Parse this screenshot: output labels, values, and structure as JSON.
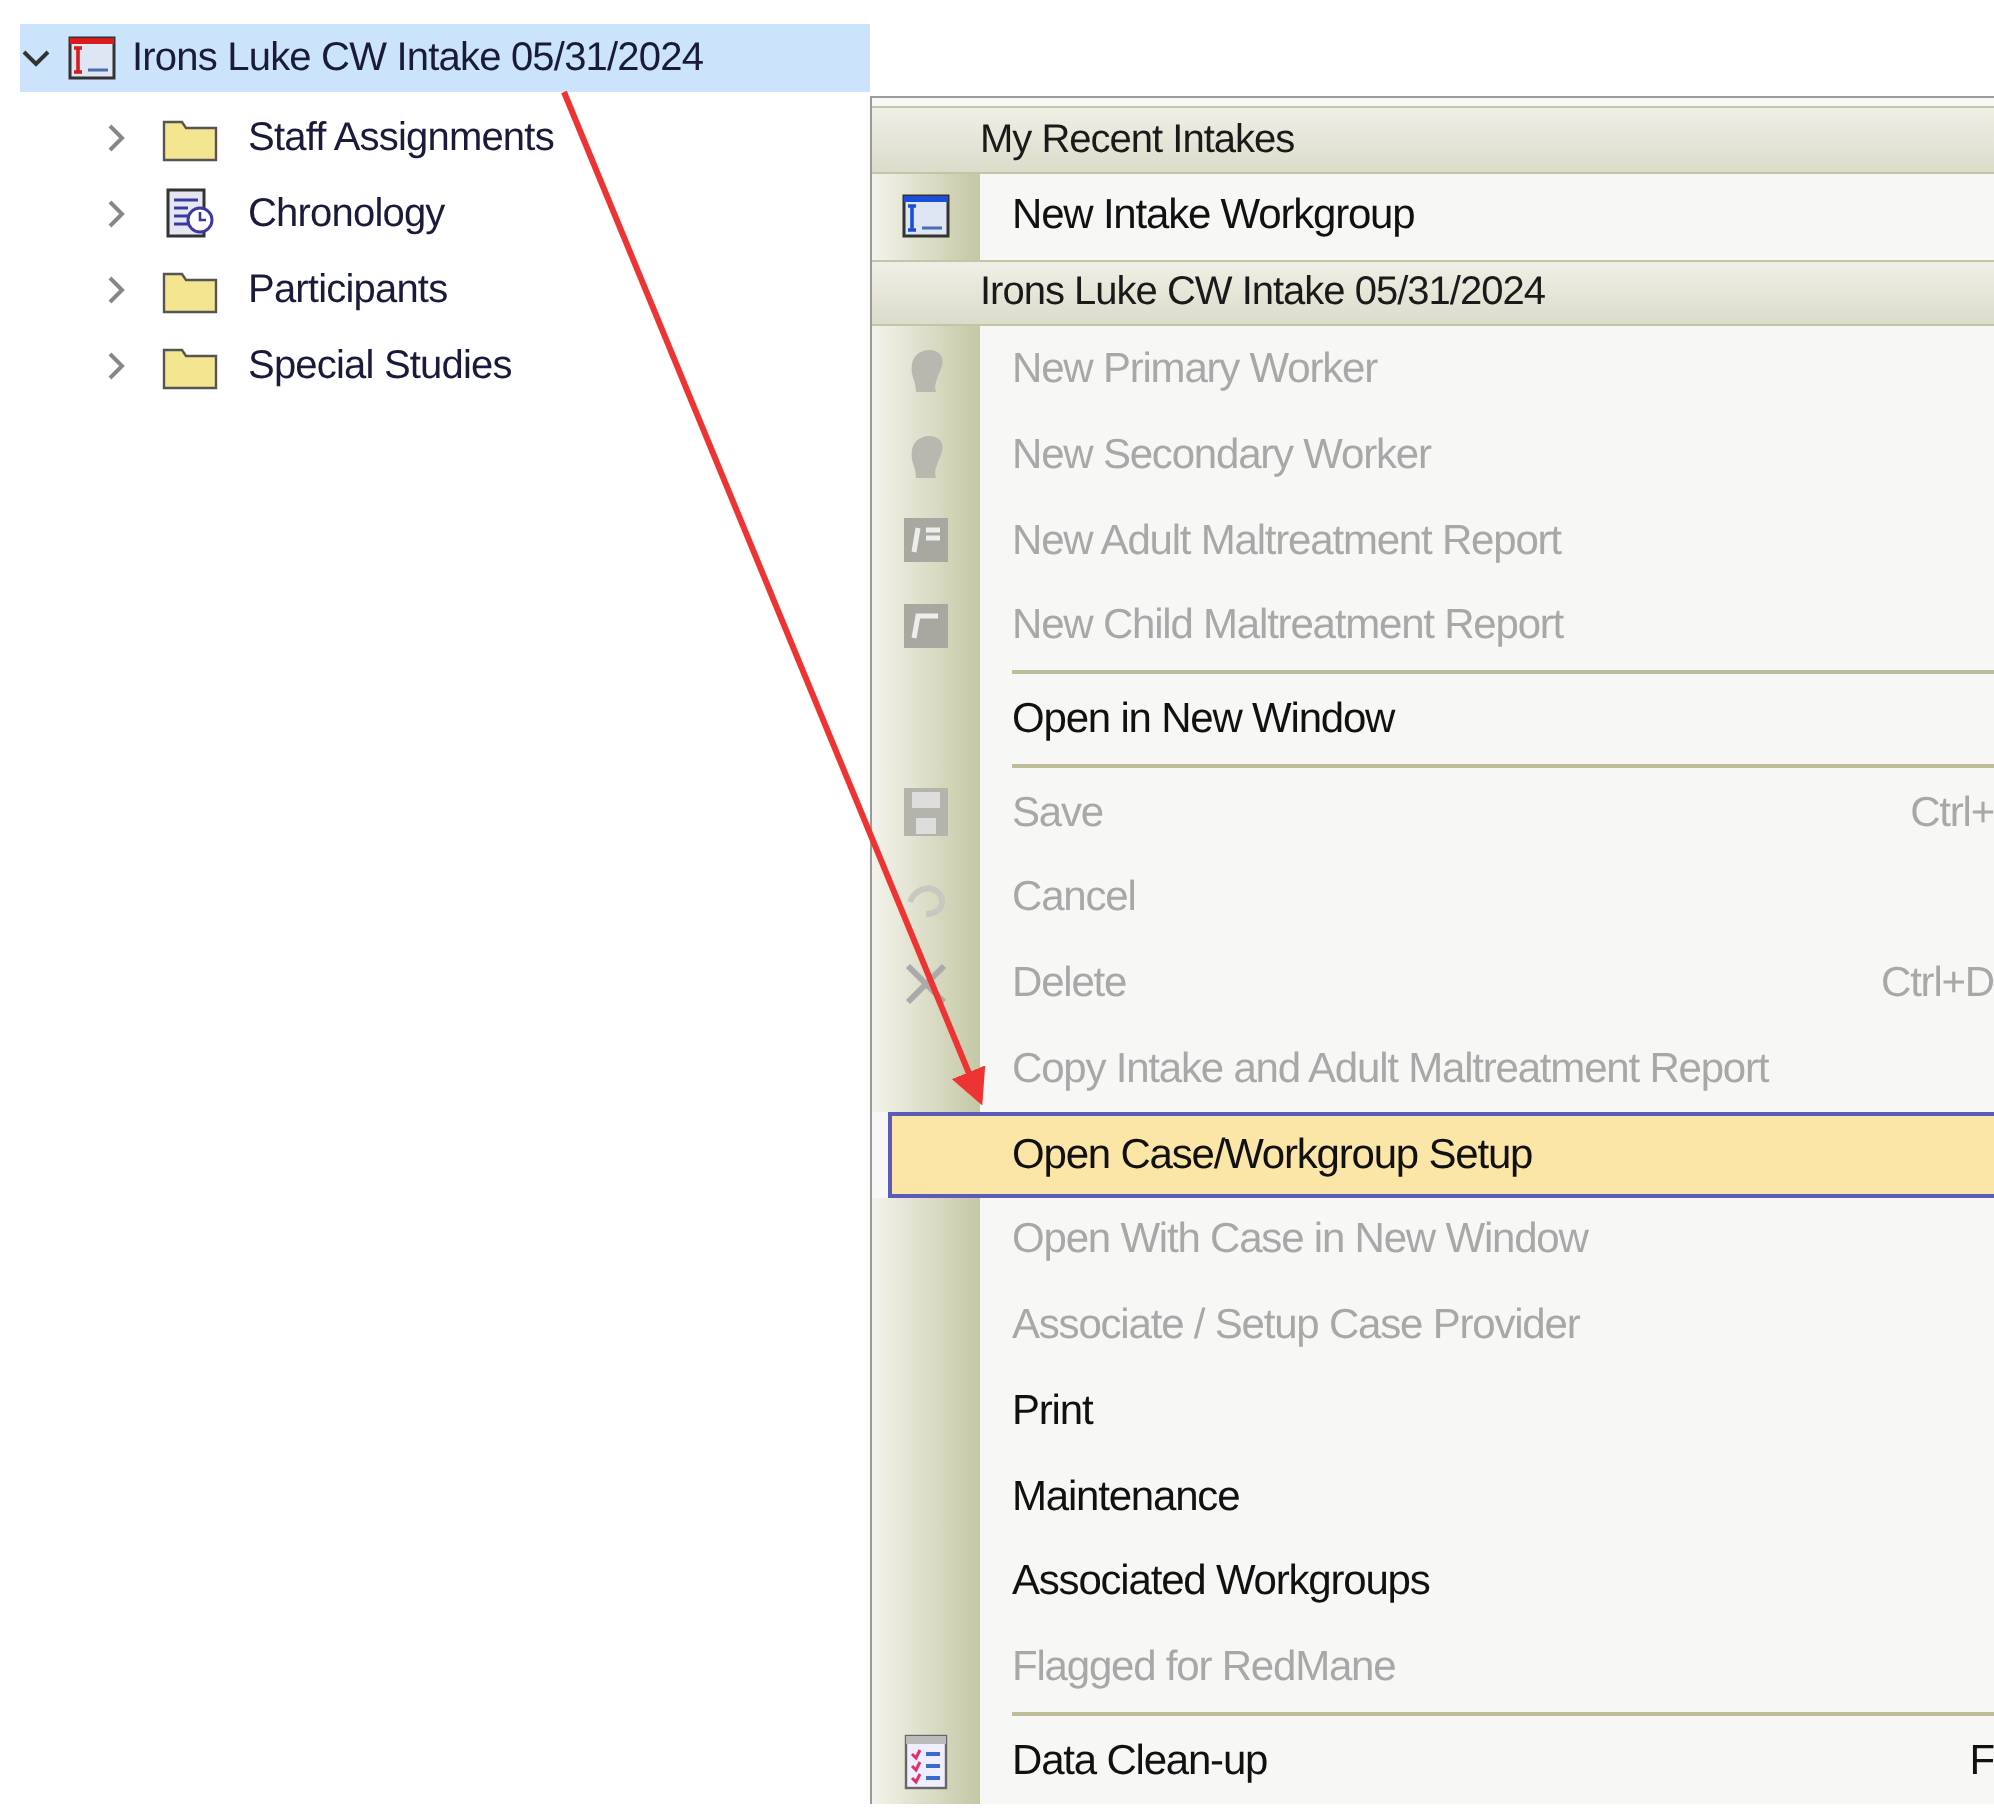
{
  "tree": {
    "label": "Irons Luke CW Intake 05/31/2024",
    "selected": true,
    "expanded": true,
    "children": [
      {
        "label": "Staff Assignments",
        "kind": "folder",
        "expanded": false
      },
      {
        "label": "Chronology",
        "kind": "chronology",
        "expanded": false
      },
      {
        "label": "Participants",
        "kind": "folder",
        "expanded": false
      },
      {
        "label": "Special Studies",
        "kind": "folder",
        "expanded": false
      }
    ]
  },
  "context_menu": {
    "items": [
      {
        "kind": "header",
        "label": "My Recent Intakes"
      },
      {
        "kind": "item",
        "label": "New Intake Workgroup",
        "disabled": false,
        "selected": false
      },
      {
        "kind": "header",
        "label": "Irons Luke CW Intake 05/31/2024"
      },
      {
        "kind": "item",
        "label": "New Primary Worker",
        "disabled": true,
        "selected": false
      },
      {
        "kind": "item",
        "label": "New Secondary Worker",
        "disabled": true,
        "selected": false
      },
      {
        "kind": "item",
        "label": "New Adult Maltreatment Report",
        "disabled": true,
        "selected": false
      },
      {
        "kind": "item",
        "label": "New Child Maltreatment Report",
        "disabled": true,
        "selected": false
      },
      {
        "kind": "separator"
      },
      {
        "kind": "item",
        "label": "Open in New Window",
        "disabled": false,
        "selected": false
      },
      {
        "kind": "separator"
      },
      {
        "kind": "item",
        "label": "Save",
        "shortcut": "Ctrl+",
        "disabled": true,
        "selected": false
      },
      {
        "kind": "item",
        "label": "Cancel",
        "disabled": true,
        "selected": false
      },
      {
        "kind": "item",
        "label": "Delete",
        "shortcut": "Ctrl+D",
        "disabled": true,
        "selected": false
      },
      {
        "kind": "item",
        "label": "Copy Intake and Adult Maltreatment Report",
        "disabled": true,
        "selected": false
      },
      {
        "kind": "item",
        "label": "Open Case/Workgroup Setup",
        "disabled": false,
        "selected": true
      },
      {
        "kind": "item",
        "label": "Open With Case in New Window",
        "disabled": true,
        "selected": false
      },
      {
        "kind": "item",
        "label": "Associate / Setup Case Provider",
        "disabled": true,
        "selected": false
      },
      {
        "kind": "item",
        "label": "Print",
        "disabled": false,
        "selected": false
      },
      {
        "kind": "item",
        "label": "Maintenance",
        "disabled": false,
        "selected": false
      },
      {
        "kind": "item",
        "label": "Associated Workgroups",
        "disabled": false,
        "selected": false
      },
      {
        "kind": "item",
        "label": "Flagged for RedMane",
        "disabled": true,
        "selected": false
      },
      {
        "kind": "separator"
      },
      {
        "kind": "item",
        "label": "Data Clean-up",
        "shortcut": "F",
        "disabled": false,
        "selected": false
      }
    ]
  }
}
